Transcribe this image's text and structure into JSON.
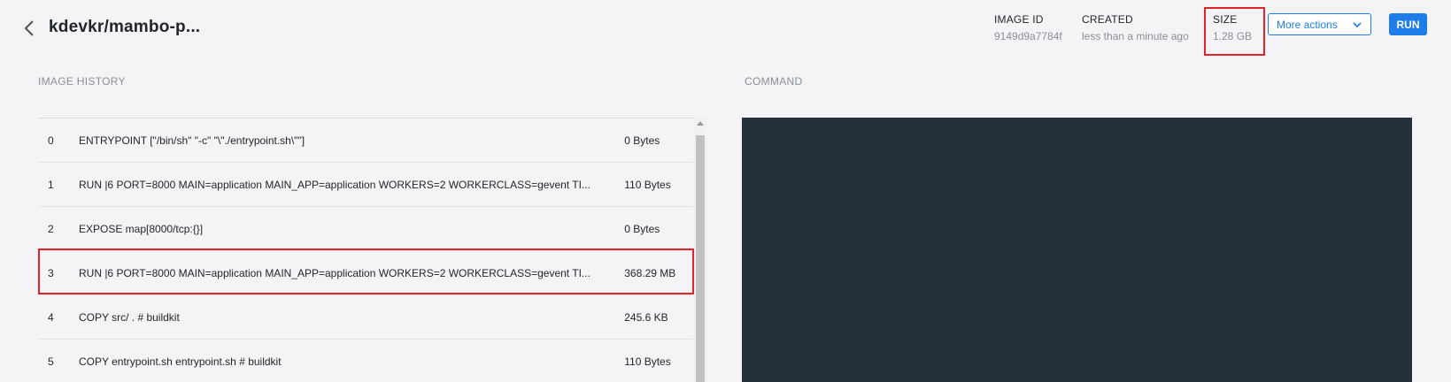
{
  "header": {
    "back_icon": "chevron-left-icon",
    "title": "kdevkr/mambo-p...",
    "image_id_label": "IMAGE ID",
    "image_id_value": "9149d9a7784f",
    "created_label": "CREATED",
    "created_value": "less than a minute ago",
    "size_label": "SIZE",
    "size_value": "1.28 GB",
    "more_actions_label": "More actions",
    "more_actions_icon": "chevron-down-icon",
    "run_label": "RUN"
  },
  "history": {
    "label": "IMAGE HISTORY",
    "rows": [
      {
        "index": "0",
        "command": "ENTRYPOINT [\"/bin/sh\" \"-c\" \"\\\"./entrypoint.sh\\\"\"]",
        "size": "0 Bytes"
      },
      {
        "index": "1",
        "command": "RUN |6 PORT=8000 MAIN=application MAIN_APP=application WORKERS=2 WORKERCLASS=gevent TI...",
        "size": "110 Bytes"
      },
      {
        "index": "2",
        "command": "EXPOSE map[8000/tcp:{}]",
        "size": "0 Bytes"
      },
      {
        "index": "3",
        "command": "RUN |6 PORT=8000 MAIN=application MAIN_APP=application WORKERS=2 WORKERCLASS=gevent TI...",
        "size": "368.29 MB"
      },
      {
        "index": "4",
        "command": "COPY src/ . # buildkit",
        "size": "245.6 KB"
      },
      {
        "index": "5",
        "command": "COPY entrypoint.sh entrypoint.sh # buildkit",
        "size": "110 Bytes"
      }
    ]
  },
  "command": {
    "label": "COMMAND"
  },
  "colors": {
    "accent": "#1e7de8",
    "highlight": "#e0242c",
    "command_panel": "#25303a",
    "background": "#f4f4f6"
  }
}
